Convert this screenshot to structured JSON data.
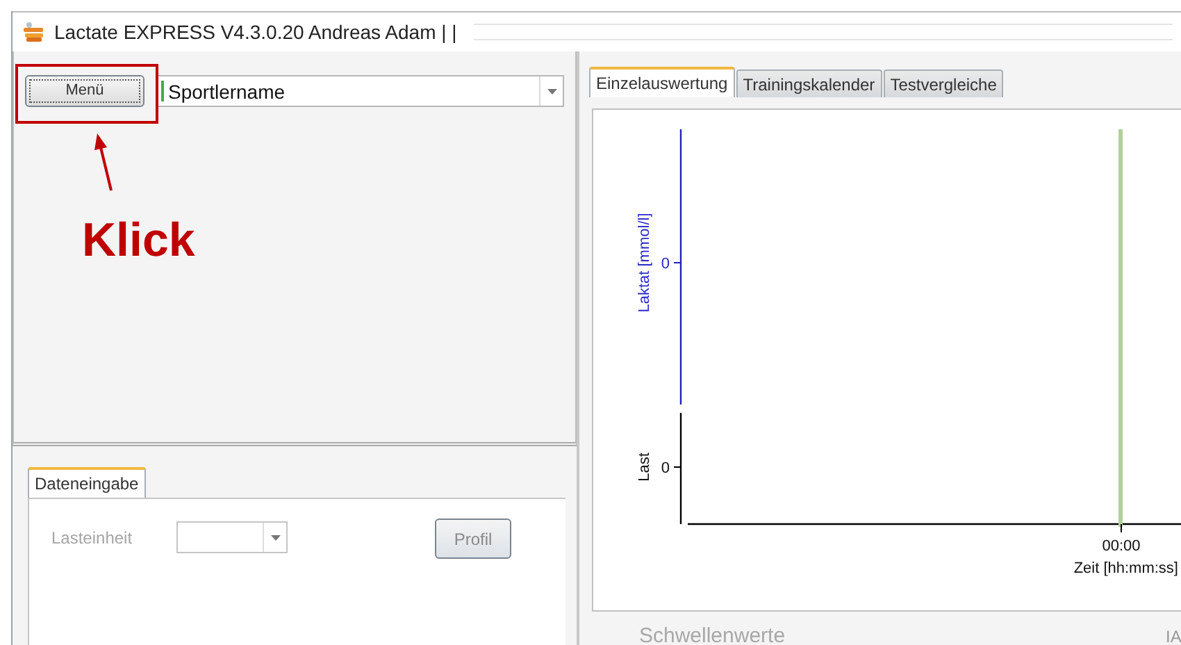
{
  "window": {
    "title": "Lactate EXPRESS V4.3.0.20 Andreas Adam |  |"
  },
  "menu_button": {
    "label": "Menü"
  },
  "athlete_select": {
    "value": "Sportlername"
  },
  "data_entry": {
    "tabs": [
      {
        "label": "Dateneingabe",
        "selected": true
      }
    ],
    "disabled": true,
    "load_unit_label": "Lasteinheit",
    "profile_button": "Profil"
  },
  "tabs": [
    {
      "label": "Einzelauswertung",
      "selected": true
    },
    {
      "label": "Trainingskalender",
      "selected": false
    },
    {
      "label": "Testvergleiche",
      "selected": false
    }
  ],
  "chart": {
    "lactate_axis_label": "Laktat [mmol/l]",
    "lactate_tick": "0",
    "load_axis_label": "Last",
    "load_tick": "0",
    "x_tick": "00:00",
    "x_axis_label": "Zeit [hh:mm:ss]"
  },
  "thresholds": {
    "title": "Schwellenwerte",
    "column_1": "IA"
  },
  "annotation": {
    "label": "Klick"
  }
}
